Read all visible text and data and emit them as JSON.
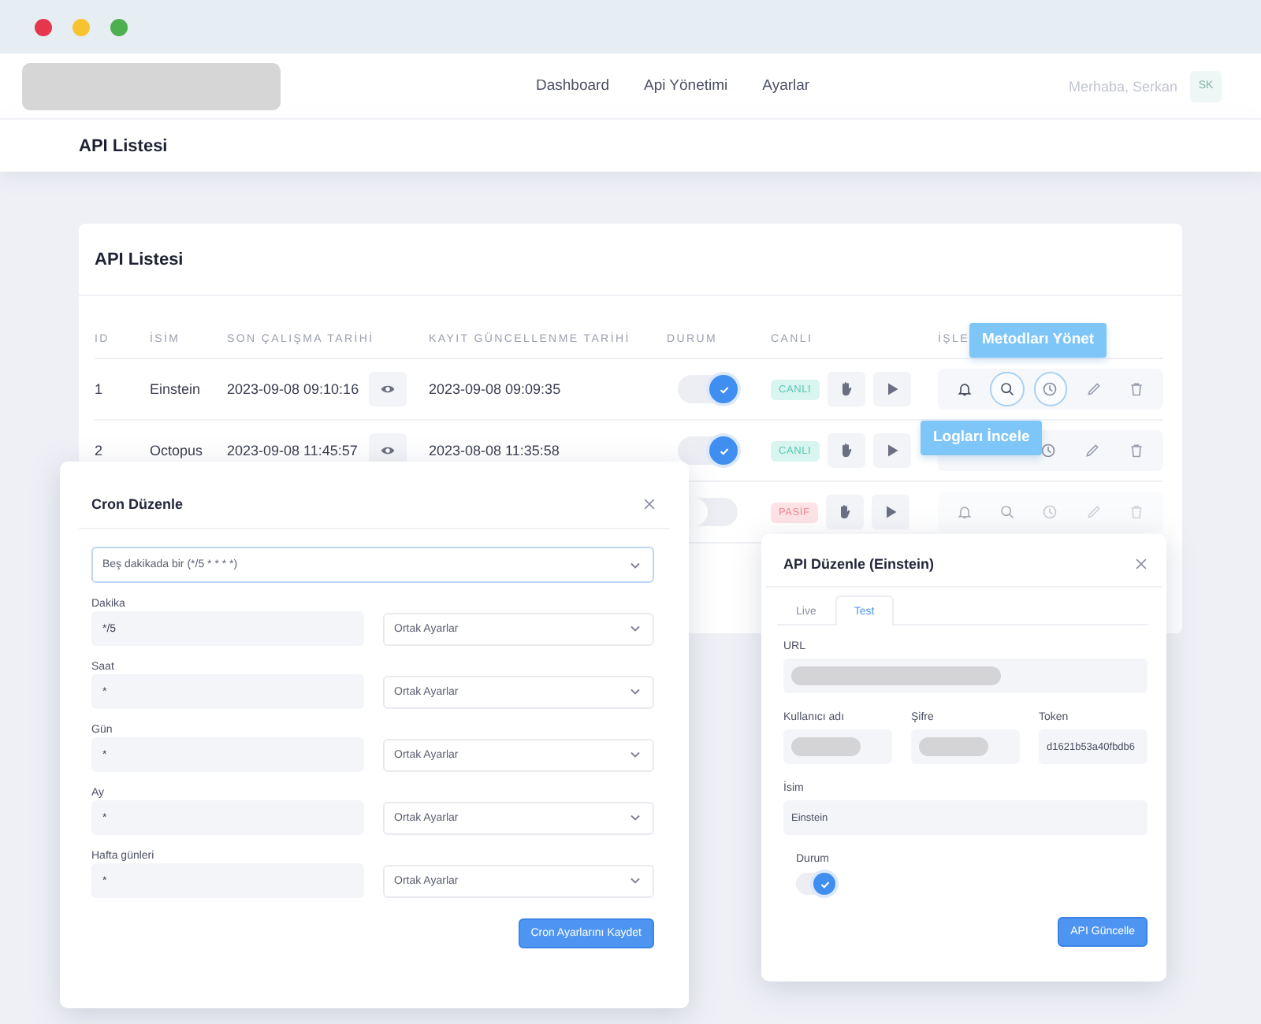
{
  "window_controls": [
    {
      "color": "#e5364d"
    },
    {
      "color": "#f6c431"
    },
    {
      "color": "#4caf50"
    }
  ],
  "header": {
    "nav": [
      {
        "label": "Dashboard"
      },
      {
        "label": "Api Yönetimi"
      },
      {
        "label": "Ayarlar"
      }
    ],
    "greeting": "Merhaba, Serkan",
    "avatar": "SK"
  },
  "page_title": "API Listesi",
  "card": {
    "title": "API Listesi",
    "columns": [
      "ID",
      "İSİM",
      "SON ÇALIŞMA TARİHİ",
      "KAYIT GÜNCELLENME TARİHİ",
      "DURUM",
      "CANLI",
      "İŞLE"
    ],
    "rows": [
      {
        "id": "1",
        "name": "Einstein",
        "last_run": "2023-09-08 09:10:16",
        "updated": "2023-09-08 09:09:35",
        "status": true,
        "live": {
          "label": "CANLI",
          "kind": "live"
        },
        "actions": [
          {
            "kind": "bell",
            "focused": false
          },
          {
            "kind": "search",
            "focused": true
          },
          {
            "kind": "methods",
            "focused": true
          },
          {
            "kind": "edit",
            "focused": false
          },
          {
            "kind": "delete",
            "focused": false
          }
        ]
      },
      {
        "id": "2",
        "name": "Octopus",
        "last_run": "2023-09-08 11:45:57",
        "updated": "2023-08-08 11:35:58",
        "status": true,
        "live": {
          "label": "CANLI",
          "kind": "live"
        },
        "actions": [
          {
            "kind": "methods",
            "focused": false
          },
          {
            "kind": "edit",
            "focused": false
          },
          {
            "kind": "delete",
            "focused": false
          }
        ]
      },
      {
        "status": false,
        "live": {
          "label": "PASİF",
          "kind": "passive"
        },
        "actions": [
          {
            "kind": "bell",
            "focused": false
          },
          {
            "kind": "search",
            "focused": false
          },
          {
            "kind": "methods",
            "focused": false
          },
          {
            "kind": "edit",
            "focused": false
          },
          {
            "kind": "delete",
            "focused": false
          }
        ]
      }
    ],
    "tooltips": [
      {
        "text": "Metodları Yönet",
        "kind": "methods"
      },
      {
        "text": "Logları İncele",
        "kind": "logs"
      }
    ]
  },
  "cron_modal": {
    "title": "Cron Düzenle",
    "preset": "Beş dakikada bir (*/5 * * * *)",
    "fields": [
      {
        "label": "Dakika",
        "value": "*/5",
        "preset": "Ortak Ayarlar"
      },
      {
        "label": "Saat",
        "value": "*",
        "preset": "Ortak Ayarlar"
      },
      {
        "label": "Gün",
        "value": "*",
        "preset": "Ortak Ayarlar"
      },
      {
        "label": "Ay",
        "value": "*",
        "preset": "Ortak Ayarlar"
      },
      {
        "label": "Hafta günleri",
        "value": "*",
        "preset": "Ortak Ayarlar"
      }
    ],
    "save_button": "Cron Ayarlarını Kaydet"
  },
  "api_modal": {
    "title": "API Düzenle (Einstein)",
    "tabs": [
      {
        "label": "Live",
        "selected": false
      },
      {
        "label": "Test",
        "selected": true
      }
    ],
    "field_rows": [
      [
        {
          "label": "URL",
          "kind": "masked"
        }
      ],
      [
        {
          "label": "Kullanıcı adı",
          "kind": "masked"
        },
        {
          "label": "Şifre",
          "kind": "masked"
        },
        {
          "label": "Token",
          "kind": "text",
          "value": "d1621b53a40fbdb6"
        }
      ],
      [
        {
          "label": "İsim",
          "kind": "text",
          "value": "Einstein"
        }
      ]
    ],
    "status_label": "Durum",
    "status_on": true,
    "button": "API Güncelle"
  }
}
